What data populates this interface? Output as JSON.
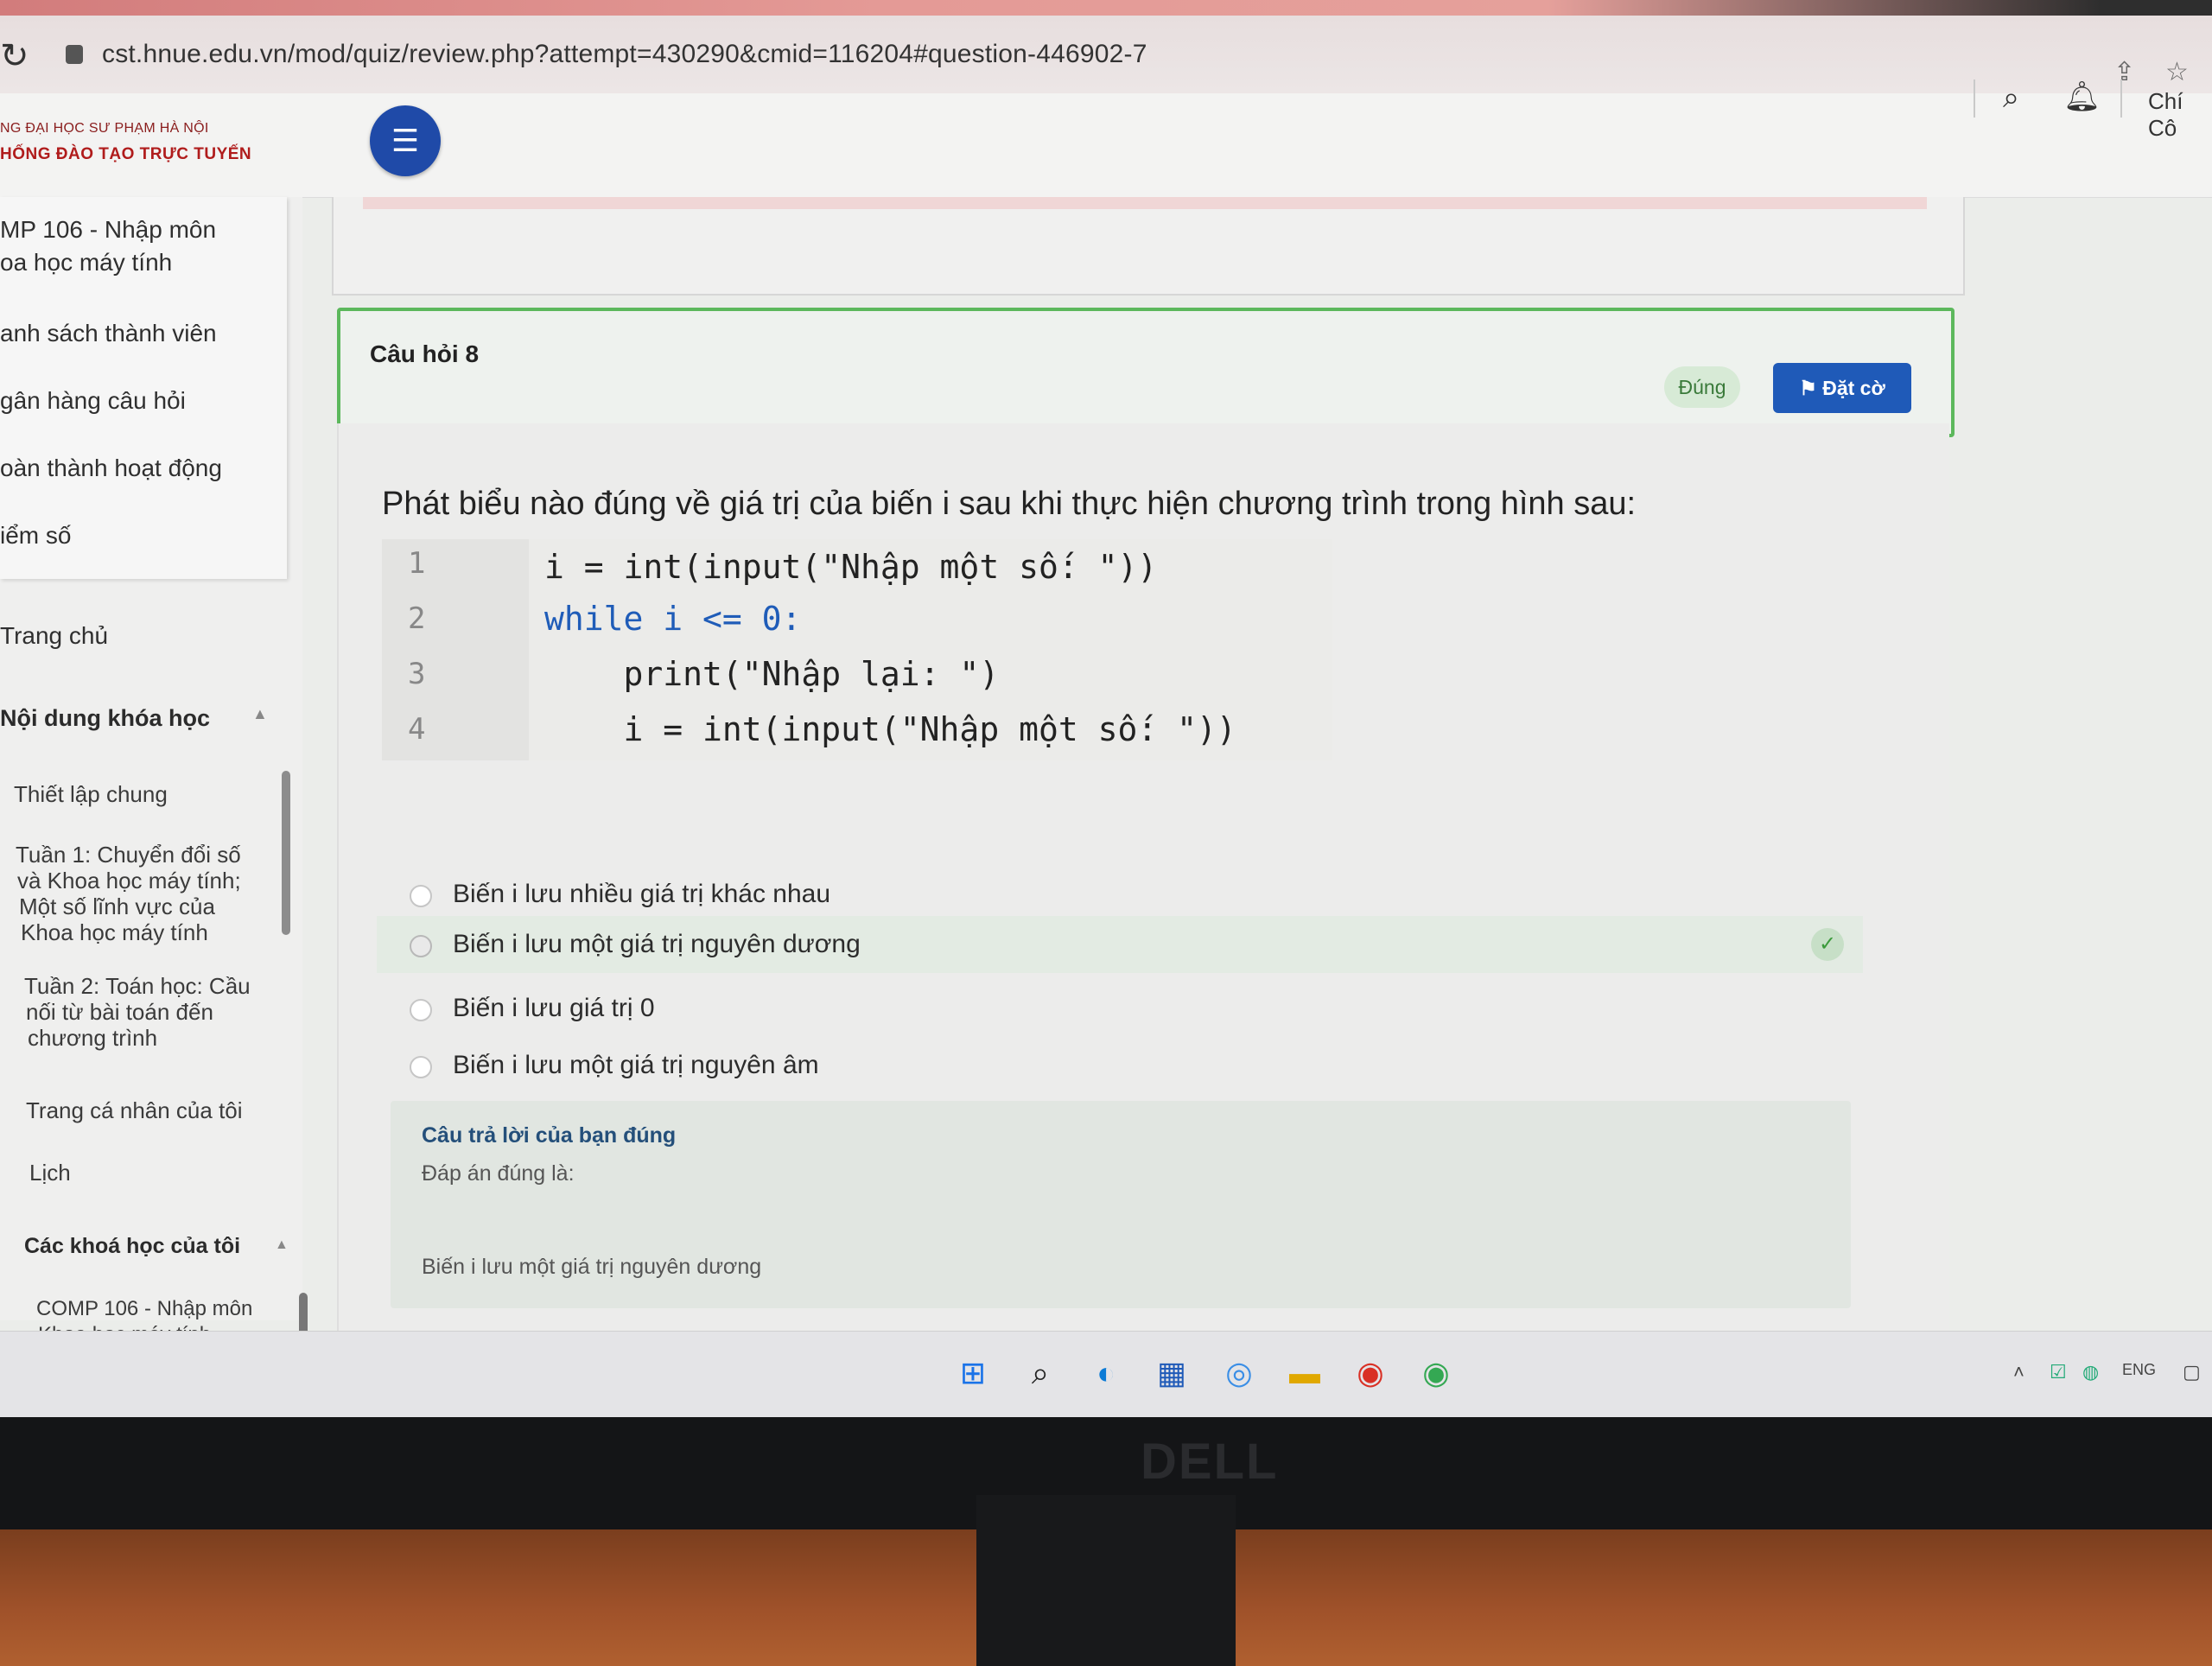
{
  "browser": {
    "url": "cst.hnue.edu.vn/mod/quiz/review.php?attempt=430290&cmid=116204#question-446902-7"
  },
  "header": {
    "logo_line1": "NG ĐẠI HỌC SƯ PHẠM HÀ NỘI",
    "logo_line2": "HỐNG ĐÀO TẠO TRỰC TUYẾN",
    "username": "Chí Cô"
  },
  "sidebar": {
    "course_items": [
      "MP 106 - Nhập môn",
      "oa học máy tính",
      "anh sách thành viên",
      "gân hàng câu hỏi",
      "oàn thành hoạt động",
      "iểm số"
    ],
    "home": "Trang chủ",
    "course_content_heading": "Nội dung khóa học",
    "sections": [
      "Thiết lập chung",
      "Tuần 1: Chuyển đổi số",
      "và Khoa học máy tính;",
      "Một số lĩnh vực của",
      "Khoa học máy tính",
      "Tuần 2: Toán học: Cầu",
      "nối từ bài toán đến",
      "chương trình"
    ],
    "my_page": "Trang cá nhân của tôi",
    "calendar": "Lịch",
    "my_courses_heading": "Các khoá học của tôi",
    "my_courses": [
      "COMP 106 - Nhập môn",
      "Khoa học máy tính"
    ]
  },
  "question": {
    "number_label": "Câu hỏi 8",
    "status_badge": "Đúng",
    "flag_label": "Đặt cờ",
    "text": "Phát biểu nào đúng về giá trị của biến i sau khi thực hiện chương trình trong hình sau:",
    "code_lines": [
      {
        "no": "1",
        "code": "i = int(input(\"Nhập một số: \"))"
      },
      {
        "no": "2",
        "code": "while i <= 0:"
      },
      {
        "no": "3",
        "code": "    print(\"Nhập lại: \")"
      },
      {
        "no": "4",
        "code": "    i = int(input(\"Nhập một số: \"))"
      }
    ],
    "options": [
      "Biến i lưu nhiều giá trị khác nhau",
      "Biến i lưu một giá trị nguyên dương",
      "Biến i lưu giá trị 0",
      "Biến i lưu một giá trị nguyên âm"
    ],
    "selected_index": 1,
    "feedback_title": "Câu trả lời của bạn đúng",
    "feedback_answer_label": "Đáp án đúng là:",
    "feedback_answer": "Biến i lưu một giá trị nguyên dương"
  },
  "taskbar": {
    "tray_lang": "ENG"
  },
  "monitor": {
    "brand": "DELL"
  },
  "colors": {
    "correct_border": "#5cb85c",
    "flag_button": "#1f5ab8",
    "hamburger": "#1f4aa8"
  }
}
